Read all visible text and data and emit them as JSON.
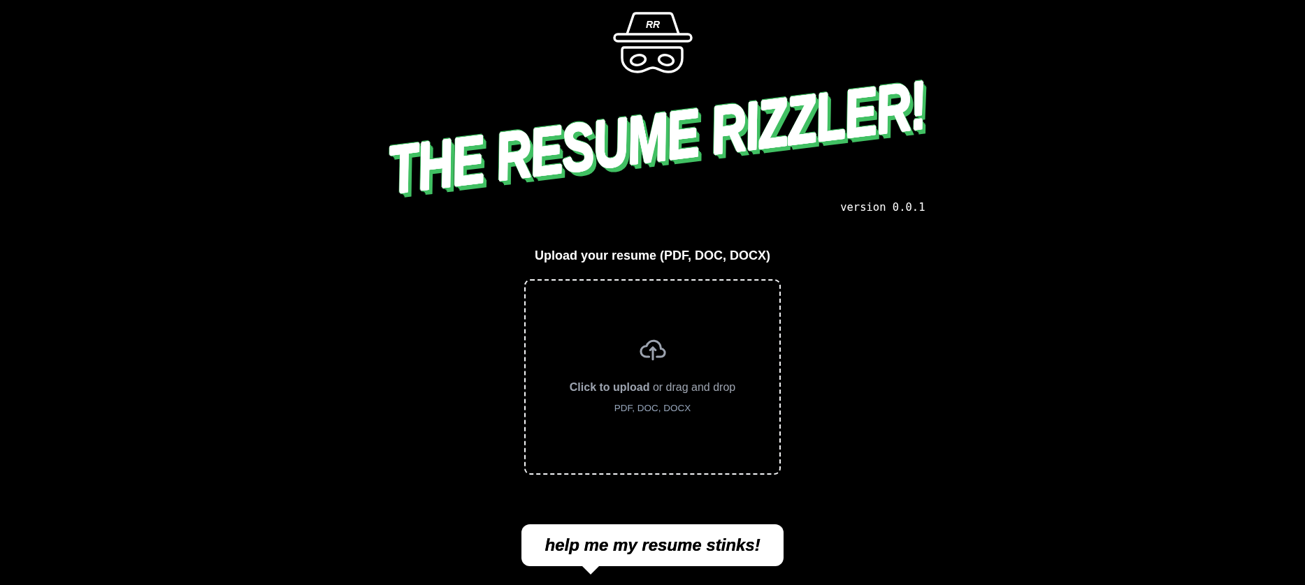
{
  "logo": {
    "monogram": "RR"
  },
  "title": "THE RESUME RIZZLER!",
  "version": "version 0.0.1",
  "upload": {
    "label": "Upload your resume (PDF, DOC, DOCX)",
    "prompt": "**Click to upload** or drag and drop",
    "formats": "PDF, DOC, DOCX"
  },
  "action_button": {
    "label": "help me my resume stinks!"
  }
}
